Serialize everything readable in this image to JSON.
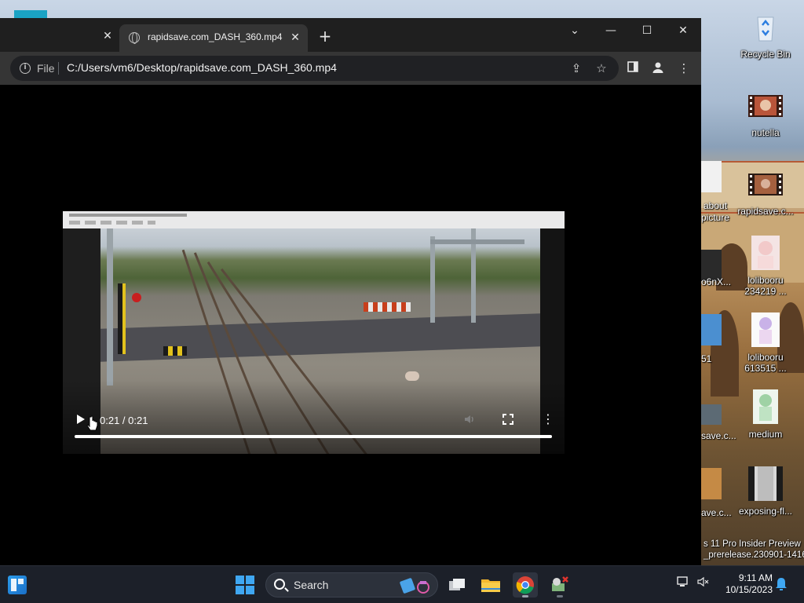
{
  "browser": {
    "active_tab_title": "rapidsave.com_DASH_360.mp4",
    "address_scheme": "File",
    "address_url": "C:/Users/vm6/Desktop/rapidsave.com_DASH_360.mp4"
  },
  "video": {
    "time": "0:21 / 0:21",
    "progress_fraction": 1.0
  },
  "desktop": {
    "icons": [
      {
        "label": "Recycle Bin",
        "icon": "recycle-bin-icon"
      },
      {
        "label": "nutella",
        "icon": "video-file-icon"
      },
      {
        "label": "rapidsave.c...",
        "icon": "video-file-icon"
      },
      {
        "label": "lolibooru 234219 ...",
        "icon": "image-file-icon"
      },
      {
        "label": "lolibooru 613515 ...",
        "icon": "image-file-icon"
      },
      {
        "label": "medium",
        "icon": "image-file-icon"
      },
      {
        "label": "exposing-fl...",
        "icon": "image-file-icon"
      }
    ],
    "partial_labels": [
      "about",
      "picture",
      "o6nX...",
      "51",
      "save.c...",
      "ave.c..."
    ],
    "watermark_line1": "s 11 Pro Insider Preview",
    "watermark_line2": "_prerelease.230901-1416"
  },
  "taskbar": {
    "search_placeholder": "Search",
    "time": "9:11 AM",
    "date": "10/15/2023"
  },
  "colors": {
    "browser_frame": "#1f1f1f",
    "toolbar": "#353535",
    "taskbar": "#1c2029",
    "accent": "#3fa7f2"
  }
}
